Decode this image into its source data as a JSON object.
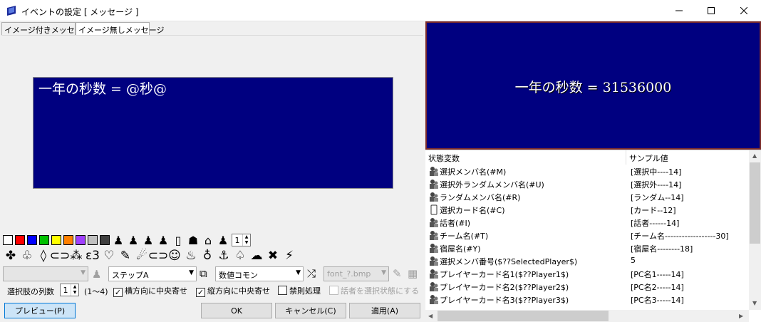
{
  "window": {
    "title": "イベントの設定 [ メッセージ ]",
    "controls": {
      "minimize": "—",
      "maximize": "☐",
      "close": "✕"
    }
  },
  "tabs": [
    {
      "label": "イメージ付きメッセージ",
      "active": false
    },
    {
      "label": "イメージ無しメッセージ",
      "active": true
    }
  ],
  "editor": {
    "message_text": "一年の秒数 = @秒@",
    "bg_color": "#000080"
  },
  "toolbar": {
    "colors": [
      "#ffffff",
      "#ff0000",
      "#0000ff",
      "#00c000",
      "#ffff00",
      "#ff8000",
      "#a040ff",
      "#c0c0c0",
      "#404040"
    ],
    "size_value": "1"
  },
  "symbols": [
    "✤",
    "♧",
    "◊",
    "⊂⊃",
    "⁂",
    "ε3",
    "♡",
    "✎",
    "☄",
    "⊂⊃",
    "☺",
    "♨",
    "♁",
    "⚓",
    "♤",
    "☁",
    "✖",
    "⚡"
  ],
  "controls": {
    "combo_1": "",
    "combo_step": "ステップA",
    "combo_value": "数値コモン",
    "combo_font": "font_?.bmp",
    "choice_cols_label": "選択肢の列数",
    "choice_cols_value": "1",
    "choice_cols_range": "(1〜4)",
    "center_h": "横方向に中央寄せ",
    "center_v": "縦方向に中央寄せ",
    "forbid": "禁則処理",
    "speaker_select": "話者を選択状態にする"
  },
  "buttons": {
    "preview": "プレビュー(P)",
    "ok": "OK",
    "cancel": "キャンセル(C)",
    "apply": "適用(A)"
  },
  "preview": {
    "text": "一年の秒数 = 31536000"
  },
  "grid": {
    "headers": [
      "状態変数",
      "サンプル値"
    ],
    "rows": [
      {
        "var": "選択メンバ名(#M)",
        "sample": "[選択中----14]"
      },
      {
        "var": "選択外ランダムメンバ名(#U)",
        "sample": "[選択外----14]"
      },
      {
        "var": "ランダムメンバ名(#R)",
        "sample": "[ランダム--14]"
      },
      {
        "var": "選択カード名(#C)",
        "sample": "[カード--12]"
      },
      {
        "var": "話者(#I)",
        "sample": "[話者------14]"
      },
      {
        "var": "チーム名(#T)",
        "sample": "[チーム名------------------30]"
      },
      {
        "var": "宿屋名(#Y)",
        "sample": "[宿屋名--------18]"
      },
      {
        "var": "選択メンバ番号($??SelectedPlayer$)",
        "sample": "5"
      },
      {
        "var": "プレイヤーカード名1($??Player1$)",
        "sample": "[PC名1-----14]"
      },
      {
        "var": "プレイヤーカード名2($??Player2$)",
        "sample": "[PC名2-----14]"
      },
      {
        "var": "プレイヤーカード名3($??Player3$)",
        "sample": "[PC名3-----14]"
      }
    ]
  }
}
